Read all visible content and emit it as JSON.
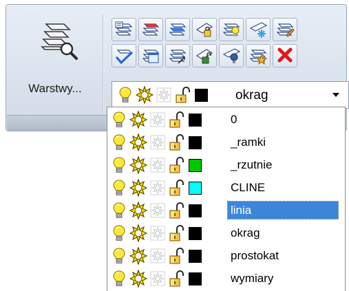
{
  "ribbon": {
    "layer_button_label": "Warstwy...",
    "current_layer": {
      "name": "okrag",
      "color": "#000000"
    }
  },
  "icons": {
    "on": "lightbulb-icon",
    "freeze": "sun-icon",
    "viewport_freeze": "sun-viewport-icon",
    "lock": "open-padlock-icon"
  },
  "layers": [
    {
      "name": "0",
      "color": "#000000"
    },
    {
      "name": "_ramki",
      "color": "#000000"
    },
    {
      "name": "_rzutnie",
      "color": "#00c800"
    },
    {
      "name": "CLINE",
      "color": "#00ffff"
    },
    {
      "name": "linia",
      "color": "#000000",
      "selected": true
    },
    {
      "name": "okrag",
      "color": "#000000"
    },
    {
      "name": "prostokat",
      "color": "#000000"
    },
    {
      "name": "wymiary",
      "color": "#000000"
    }
  ]
}
